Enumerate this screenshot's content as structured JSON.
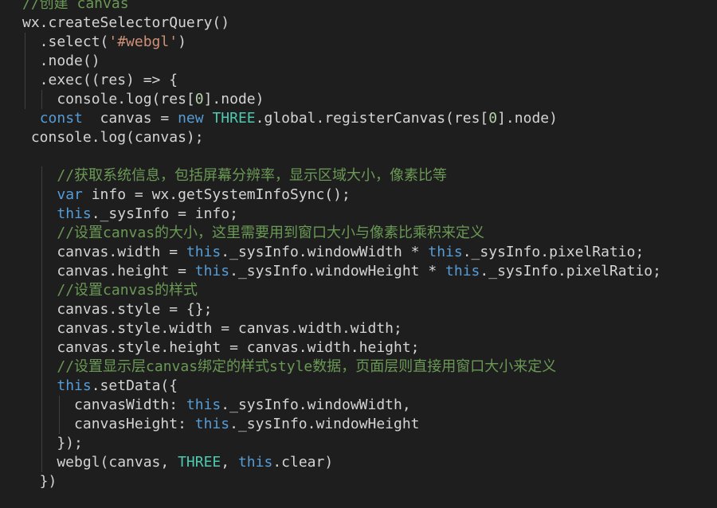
{
  "editor": {
    "language": "javascript",
    "theme": {
      "background": "#1e1e1e",
      "text": "#d4d4d4",
      "keyword": "#569cd6",
      "string": "#ce9178",
      "number": "#b5cea8",
      "class": "#4ec9b0",
      "comment": "#6a9955",
      "indent_guide": "#404040"
    },
    "lines": [
      {
        "tokens": [
          {
            "t": "//创建 canvas",
            "c": "comment"
          }
        ]
      },
      {
        "tokens": [
          {
            "t": "wx.createSelectorQuery()",
            "c": "text"
          }
        ]
      },
      {
        "tokens": [
          {
            "t": "  .select(",
            "c": "text"
          },
          {
            "t": "'#webgl'",
            "c": "str"
          },
          {
            "t": ")",
            "c": "text"
          }
        ]
      },
      {
        "tokens": [
          {
            "t": "  .node()",
            "c": "text"
          }
        ]
      },
      {
        "tokens": [
          {
            "t": "  .exec((res) => {",
            "c": "text"
          }
        ]
      },
      {
        "tokens": [
          {
            "t": "    console.log(res[",
            "c": "text"
          },
          {
            "t": "0",
            "c": "num"
          },
          {
            "t": "].node)",
            "c": "text"
          }
        ]
      },
      {
        "tokens": [
          {
            "t": "  ",
            "c": "text"
          },
          {
            "t": "const",
            "c": "kw"
          },
          {
            "t": "  canvas = ",
            "c": "text"
          },
          {
            "t": "new",
            "c": "kw"
          },
          {
            "t": " ",
            "c": "text"
          },
          {
            "t": "THREE",
            "c": "class"
          },
          {
            "t": ".global.registerCanvas(res[",
            "c": "text"
          },
          {
            "t": "0",
            "c": "num"
          },
          {
            "t": "].node)",
            "c": "text"
          }
        ]
      },
      {
        "tokens": [
          {
            "t": " console.log(canvas);",
            "c": "text"
          }
        ]
      },
      {
        "tokens": []
      },
      {
        "tokens": [
          {
            "t": "    ",
            "c": "text"
          },
          {
            "t": "//获取系统信息，包括屏幕分辨率，显示区域大小，像素比等",
            "c": "comment"
          }
        ]
      },
      {
        "tokens": [
          {
            "t": "    ",
            "c": "text"
          },
          {
            "t": "var",
            "c": "kw"
          },
          {
            "t": " info = wx.getSystemInfoSync();",
            "c": "text"
          }
        ]
      },
      {
        "tokens": [
          {
            "t": "    ",
            "c": "text"
          },
          {
            "t": "this",
            "c": "kw"
          },
          {
            "t": "._sysInfo = info;",
            "c": "text"
          }
        ]
      },
      {
        "tokens": [
          {
            "t": "    ",
            "c": "text"
          },
          {
            "t": "//设置canvas的大小，这里需要用到窗口大小与像素比乘积来定义",
            "c": "comment"
          }
        ]
      },
      {
        "tokens": [
          {
            "t": "    canvas.width = ",
            "c": "text"
          },
          {
            "t": "this",
            "c": "kw"
          },
          {
            "t": "._sysInfo.windowWidth * ",
            "c": "text"
          },
          {
            "t": "this",
            "c": "kw"
          },
          {
            "t": "._sysInfo.pixelRatio;",
            "c": "text"
          }
        ]
      },
      {
        "tokens": [
          {
            "t": "    canvas.height = ",
            "c": "text"
          },
          {
            "t": "this",
            "c": "kw"
          },
          {
            "t": "._sysInfo.windowHeight * ",
            "c": "text"
          },
          {
            "t": "this",
            "c": "kw"
          },
          {
            "t": "._sysInfo.pixelRatio;",
            "c": "text"
          }
        ]
      },
      {
        "tokens": [
          {
            "t": "    ",
            "c": "text"
          },
          {
            "t": "//设置canvas的样式",
            "c": "comment"
          }
        ]
      },
      {
        "tokens": [
          {
            "t": "    canvas.style = {};",
            "c": "text"
          }
        ]
      },
      {
        "tokens": [
          {
            "t": "    canvas.style.width = canvas.width.width;",
            "c": "text"
          }
        ]
      },
      {
        "tokens": [
          {
            "t": "    canvas.style.height = canvas.width.height;",
            "c": "text"
          }
        ]
      },
      {
        "tokens": [
          {
            "t": "    ",
            "c": "text"
          },
          {
            "t": "//设置显示层canvas绑定的样式style数据，页面层则直接用窗口大小来定义",
            "c": "comment"
          }
        ]
      },
      {
        "tokens": [
          {
            "t": "    ",
            "c": "text"
          },
          {
            "t": "this",
            "c": "kw"
          },
          {
            "t": ".setData({",
            "c": "text"
          }
        ]
      },
      {
        "tokens": [
          {
            "t": "      canvasWidth: ",
            "c": "text"
          },
          {
            "t": "this",
            "c": "kw"
          },
          {
            "t": "._sysInfo.windowWidth,",
            "c": "text"
          }
        ]
      },
      {
        "tokens": [
          {
            "t": "      canvasHeight: ",
            "c": "text"
          },
          {
            "t": "this",
            "c": "kw"
          },
          {
            "t": "._sysInfo.windowHeight",
            "c": "text"
          }
        ]
      },
      {
        "tokens": [
          {
            "t": "    });",
            "c": "text"
          }
        ]
      },
      {
        "tokens": [
          {
            "t": "    webgl(canvas, ",
            "c": "text"
          },
          {
            "t": "THREE",
            "c": "class"
          },
          {
            "t": ", ",
            "c": "text"
          },
          {
            "t": "this",
            "c": "kw"
          },
          {
            "t": ".clear)",
            "c": "text"
          }
        ]
      },
      {
        "tokens": [
          {
            "t": "  })",
            "c": "text"
          }
        ]
      }
    ]
  }
}
